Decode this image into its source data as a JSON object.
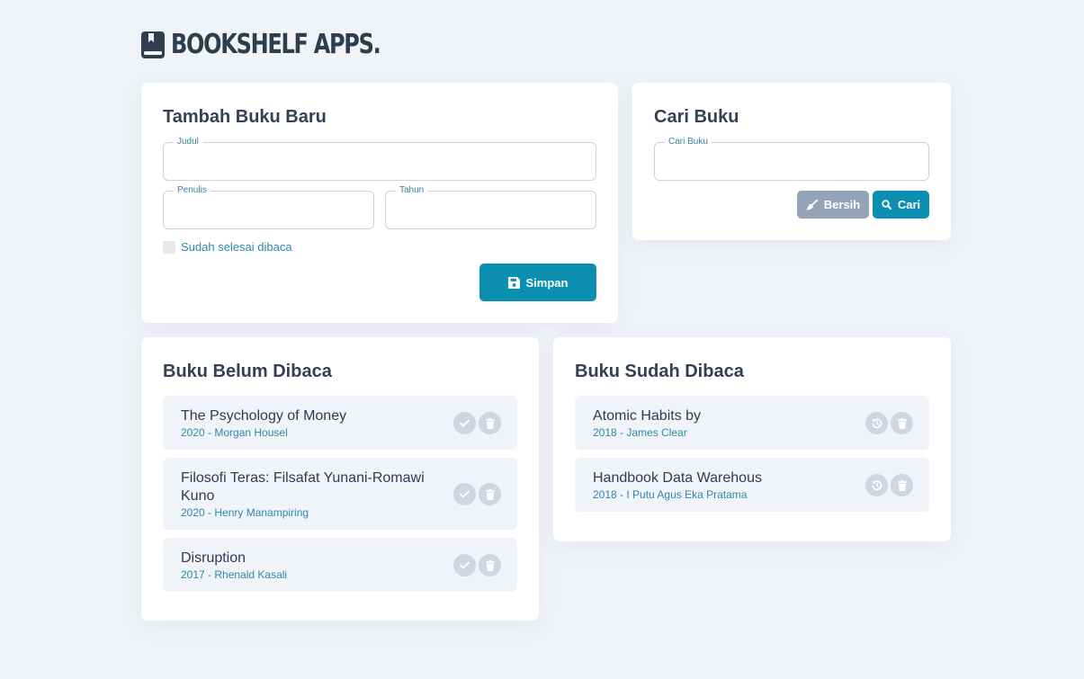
{
  "app": {
    "title": "BOOKSHELF APPS."
  },
  "add_form": {
    "heading": "Tambah Buku Baru",
    "judul_label": "Judul",
    "penulis_label": "Penulis",
    "tahun_label": "Tahun",
    "judul_value": "",
    "penulis_value": "",
    "tahun_value": "",
    "checkbox_label": "Sudah selesai dibaca",
    "submit_label": "Simpan"
  },
  "search": {
    "heading": "Cari Buku",
    "input_label": "Cari Buku",
    "input_value": "",
    "clear_label": "Bersih",
    "search_label": "Cari"
  },
  "unread": {
    "heading": "Buku Belum Dibaca",
    "books": [
      {
        "title": "The Psychology of Money",
        "meta": "2020 - Morgan Housel"
      },
      {
        "title": "Filosofi Teras: Filsafat Yunani-Romawi Kuno",
        "meta": "2020 - Henry Manampiring"
      },
      {
        "title": "Disruption",
        "meta": "2017 - Rhenald Kasali"
      }
    ]
  },
  "read": {
    "heading": "Buku Sudah Dibaca",
    "books": [
      {
        "title": "Atomic Habits by",
        "meta": "2018 - James Clear"
      },
      {
        "title": "Handbook Data Warehous",
        "meta": "2018 - I Putu Agus Eka Pratama"
      }
    ]
  },
  "icons": {
    "logo": "book-icon",
    "submit": "floppy-disk-icon",
    "clear": "broom-icon",
    "search": "magnifier-icon",
    "mark_done": "check-icon",
    "undo": "history-icon",
    "delete": "trash-icon"
  },
  "colors": {
    "background": "#f0f3f8",
    "primary": "#0b8fb1",
    "muted_button": "#94a3b8",
    "accent_text": "#2b89a8",
    "heading_text": "#334155",
    "action_circle": "#cfd6df"
  }
}
